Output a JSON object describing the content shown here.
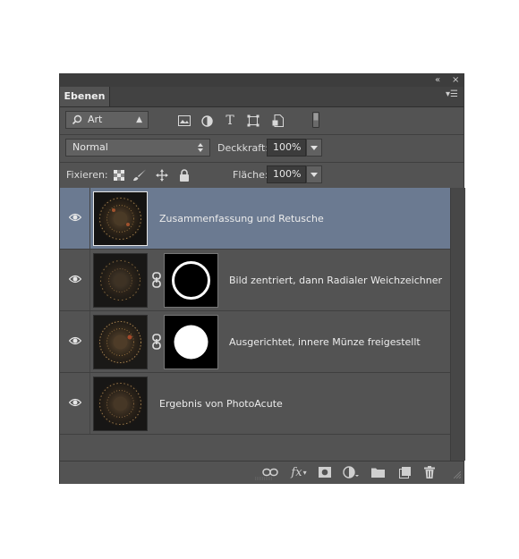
{
  "panel": {
    "collapse_glyph": "«",
    "close_glyph": "×",
    "tab_label": "Ebenen",
    "menu_glyph": "▾☰"
  },
  "filter_bar": {
    "filter_type": "Art",
    "icons": [
      "image-filter-icon",
      "adjustment-filter-icon",
      "type-filter-icon",
      "shape-filter-icon",
      "smart-object-filter-icon",
      "filter-toggle-icon"
    ]
  },
  "blend_bar": {
    "blend_mode": "Normal",
    "opacity_label": "Deckkraft:",
    "opacity_value": "100%"
  },
  "lock_bar": {
    "lock_label": "Fixieren:",
    "lock_icons": [
      "lock-transparency-icon",
      "lock-image-pixels-icon",
      "lock-position-icon",
      "lock-all-icon"
    ],
    "fill_label": "Fläche:",
    "fill_value": "100%"
  },
  "layers": [
    {
      "name": "Zusammenfassung und Retusche",
      "visible": true,
      "selected": true,
      "has_mask": false
    },
    {
      "name": "Bild zentriert, dann Radialer Weichzeichner",
      "visible": true,
      "selected": false,
      "has_mask": true,
      "mask_shape": "ring"
    },
    {
      "name": "Ausgerichtet, innere Münze freigestellt",
      "visible": true,
      "selected": false,
      "has_mask": true,
      "mask_shape": "disc"
    },
    {
      "name": "Ergebnis von PhotoAcute",
      "visible": true,
      "selected": false,
      "has_mask": false
    }
  ],
  "bottom_bar": {
    "icons": [
      "link-layers-icon",
      "layer-style-icon",
      "add-mask-icon",
      "adjustment-layer-icon",
      "new-group-icon",
      "new-layer-icon",
      "delete-layer-icon"
    ],
    "fx_label": "fx"
  },
  "colors": {
    "panel_bg": "#535353",
    "selected_row": "#6b7a91"
  }
}
